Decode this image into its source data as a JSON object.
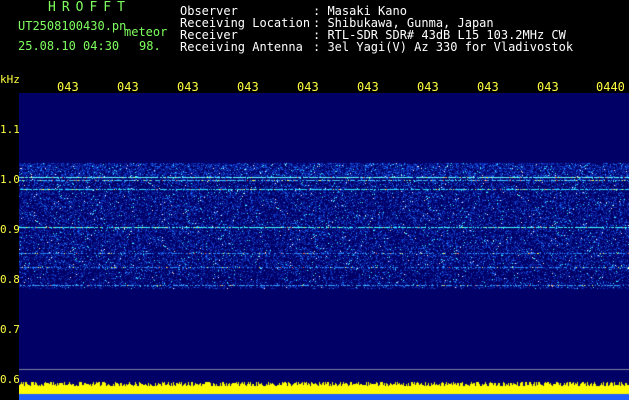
{
  "header": {
    "brand": "HROFFT",
    "filename": "UT2508100430.pn",
    "meteor_label": "meteor",
    "timestamp": "25.08.10 04:30",
    "count": "98.",
    "info": [
      {
        "label": "Observer",
        "value": ": Masaki Kano"
      },
      {
        "label": "Receiving Location",
        "value": ": Shibukawa, Gunma, Japan"
      },
      {
        "label": "Receiver",
        "value": ": RTL-SDR SDR# 43dB L15 103.2MHz CW"
      },
      {
        "label": "Receiving Antenna",
        "value": ": 3el Yagi(V) Az 330 for Vladivostok"
      }
    ]
  },
  "axis": {
    "y_unit": "kHz",
    "y_ticks": [
      "1.1",
      "1.0",
      "0.9",
      "0.8",
      "0.7",
      "0.6"
    ],
    "x_ticks": [
      "043",
      "043",
      "043",
      "043",
      "043",
      "043",
      "043",
      "043",
      "043",
      "0440"
    ]
  },
  "colors": {
    "background": "#000000",
    "spectrogram_bg": "#000066",
    "label_green": "#7fff5f",
    "label_yellow": "#ffff40",
    "text_white": "#ffffff"
  }
}
